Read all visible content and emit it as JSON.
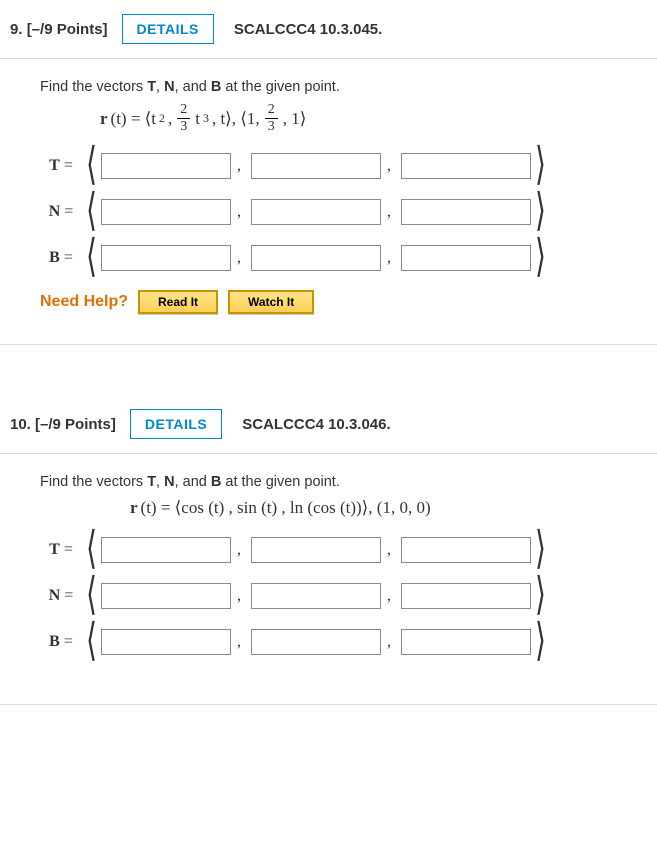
{
  "questions": [
    {
      "number": "9.",
      "points": "[–/9 Points]",
      "details_label": "DETAILS",
      "source": "SCALCCC4 10.3.045.",
      "prompt_prefix": "Find the vectors ",
      "prompt_T": "T",
      "prompt_sep1": ", ",
      "prompt_N": "N",
      "prompt_sep2": ", and ",
      "prompt_B": "B",
      "prompt_suffix": " at the given point.",
      "vector_labels": {
        "T": "T",
        "N": "N",
        "B": "B",
        "eq": " = "
      },
      "need_help": "Need Help?",
      "read_it": "Read It",
      "watch_it": "Watch It"
    },
    {
      "number": "10.",
      "points": "[–/9 Points]",
      "details_label": "DETAILS",
      "source": "SCALCCC4 10.3.046.",
      "prompt_prefix": "Find the vectors ",
      "prompt_T": "T",
      "prompt_sep1": ", ",
      "prompt_N": "N",
      "prompt_sep2": ", and ",
      "prompt_B": "B",
      "prompt_suffix": " at the given point.",
      "vector_labels": {
        "T": "T",
        "N": "N",
        "B": "B",
        "eq": " = "
      }
    }
  ],
  "formula1": {
    "r": "r",
    "paren_t_eq": " (t) = ⟨t",
    "sq": "2",
    "comma1": ", ",
    "frac_num1": "2",
    "frac_den1": "3",
    "t_cubed": "t",
    "cube": "3",
    "comma_t_close": ", t⟩,  ⟨1, ",
    "frac_num2": "2",
    "frac_den2": "3",
    "close2": ", 1⟩"
  },
  "formula2": {
    "r": "r",
    "body": " (t) = ⟨cos (t) ,  sin (t) ,  ln (cos (t))⟩,  (1, 0, 0)"
  }
}
